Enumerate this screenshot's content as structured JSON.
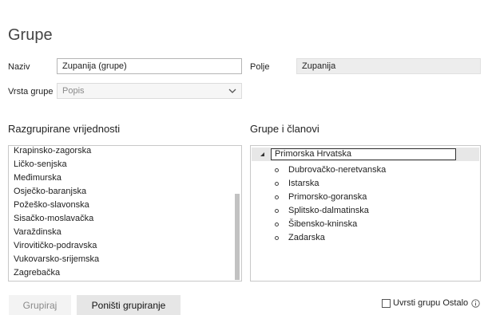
{
  "page": {
    "title": "Grupe"
  },
  "form": {
    "name_label": "Naziv",
    "name_value": "Zupanija (grupe)",
    "field_label": "Polje",
    "field_value": "Zupanija",
    "group_type_label": "Vrsta grupe",
    "group_type_value": "Popis"
  },
  "ungrouped": {
    "title": "Razgrupirane vrijednosti",
    "items": [
      "Krapinsko-zagorska",
      "Ličko-senjska",
      "Međimurska",
      "Osječko-baranjska",
      "Požeško-slavonska",
      "Sisačko-moslavačka",
      "Varaždinska",
      "Virovitičko-podravska",
      "Vukovarsko-srijemska",
      "Zagrebačka"
    ]
  },
  "groups": {
    "title": "Grupe i članovi",
    "root_label": "Primorska Hrvatska",
    "members": [
      "Dubrovačko-neretvanska",
      "Istarska",
      "Primorsko-goranska",
      "Splitsko-dalmatinska",
      "Šibensko-kninska",
      "Zadarska"
    ]
  },
  "buttons": {
    "group_label": "Grupiraj",
    "ungroup_label": "Poništi grupiranje"
  },
  "options": {
    "include_other_label": "Uvrsti grupu Ostalo",
    "include_other_checked": false
  },
  "icons": {
    "select_arrow": "chevron-down-icon",
    "tree_toggle": "expanded-triangle-icon",
    "info": "info-icon"
  }
}
